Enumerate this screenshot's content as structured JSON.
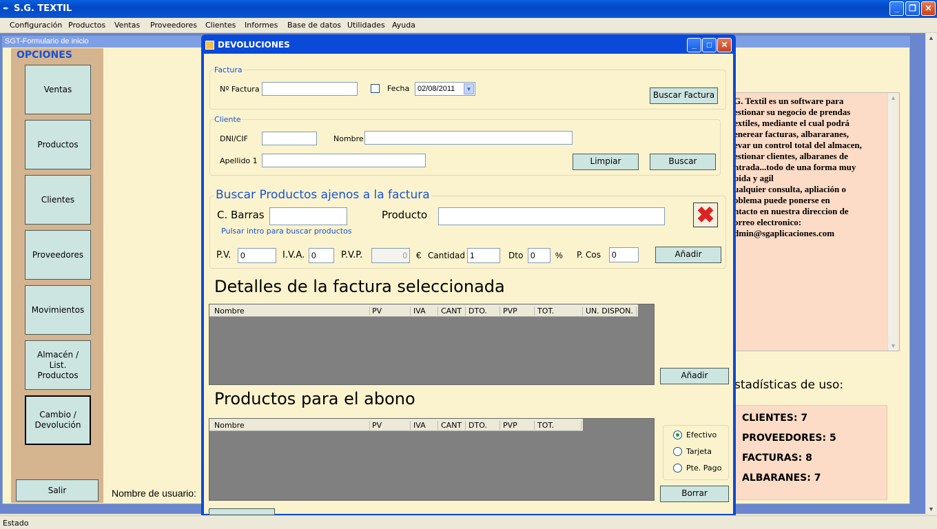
{
  "app": {
    "title": "S.G. TEXTIL"
  },
  "menu": [
    "Configuración",
    "Productos",
    "Ventas",
    "Proveedores",
    "Clientes",
    "Informes",
    "Base de datos",
    "Utilidades",
    "Ayuda"
  ],
  "child": {
    "title": "SGT-Formulario de inicio"
  },
  "sidebar": {
    "heading": "OPCIONES",
    "buttons": [
      "Ventas",
      "Productos",
      "Clientes",
      "Proveedores",
      "Movimientos",
      "Almacén / List. Productos",
      "Cambio / Devolución"
    ],
    "exit": "Salir"
  },
  "user_label": "Nombre de usuario:",
  "info": {
    "lines": [
      "G. Textil es un software para",
      "estionar su negocio de prendas",
      "extiles, mediante el cual podrá",
      "enerear facturas, albararanes,",
      "evar un control total del almacen,",
      "estionar clientes, albaranes de",
      "ntrada...todo de una forma muy",
      "pida y agil",
      "ualquier consulta, apliación o",
      "oblema puede ponerse en",
      "ntacto en nuestra direccion de",
      "orreo electronico:",
      "dmin@sgaplicaciones.com"
    ]
  },
  "stats": {
    "title": "stadísticas de uso:",
    "clientes": "CLIENTES: 7",
    "proveedores": "PROVEEDORES: 5",
    "facturas": "FACTURAS: 8",
    "albaranes": "ALBARANES: 7"
  },
  "dialog": {
    "title": "DEVOLUCIONES",
    "factura": {
      "group": "Factura",
      "num_label": "Nº Factura",
      "num_value": "",
      "fecha_label": "Fecha",
      "fecha_value": "02/08/2011",
      "buscar": "Buscar Factura"
    },
    "cliente": {
      "group": "Cliente",
      "dni_label": "DNI/CIF",
      "dni_value": "",
      "nombre_label": "Nombre",
      "nombre_value": "",
      "apellido_label": "Apellido 1",
      "apellido_value": "",
      "limpiar": "Limpiar",
      "buscar": "Buscar"
    },
    "productos": {
      "group": "Buscar Productos ajenos a la factura",
      "cbarras_label": "C. Barras",
      "cbarras_value": "",
      "producto_label": "Producto",
      "producto_value": "",
      "hint": "Pulsar intro para buscar productos",
      "pv_label": "P.V.",
      "pv_value": "0",
      "iva_label": "I.V.A.",
      "iva_value": "0",
      "pvp_label": "P.V.P.",
      "pvp_value": "0",
      "euro": "€",
      "cantidad_label": "Cantidad",
      "cantidad_value": "1",
      "dto_label": "Dto",
      "dto_value": "0",
      "pct": "%",
      "pcos_label": "P. Cos",
      "pcos_value": "0",
      "anadir": "Añadir"
    },
    "detalles": {
      "heading": "Detalles de la factura seleccionada",
      "columns": [
        "Nombre",
        "PV",
        "IVA",
        "CANT",
        "DTO.",
        "PVP",
        "TOT.",
        "UN. DISPON."
      ],
      "anadir": "Añadir"
    },
    "abono": {
      "heading": "Productos para el abono",
      "columns": [
        "Nombre",
        "PV",
        "IVA",
        "CANT",
        "DTO.",
        "PVP",
        "TOT."
      ],
      "payment": {
        "options": [
          "Efectivo",
          "Tarjeta",
          "Pte. Pago"
        ],
        "selected": "Efectivo"
      },
      "borrar": "Borrar"
    }
  },
  "statusbar": "Estado",
  "colors": {
    "title_blue": "#0b4ad8",
    "form_bg": "#fbf3cd",
    "button_teal": "#cde5e1",
    "sidebar_tan": "#d5b490",
    "info_peach": "#fcdcc6",
    "delete_red": "#d22"
  }
}
